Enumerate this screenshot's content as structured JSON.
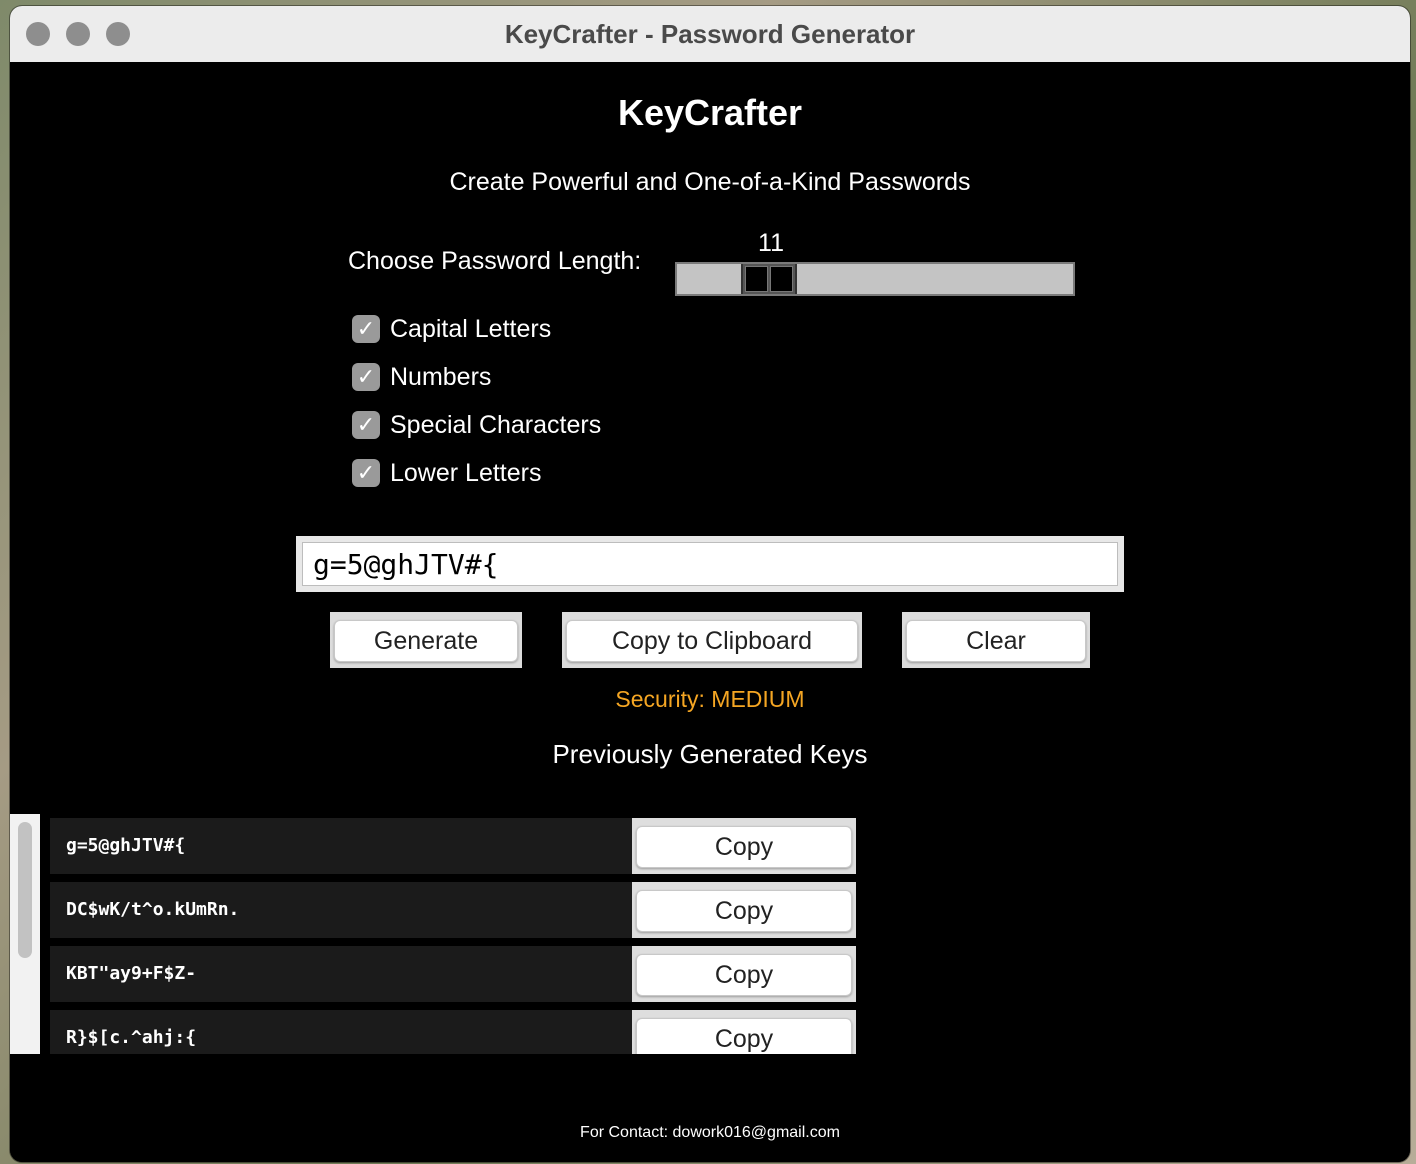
{
  "window": {
    "title": "KeyCrafter - Password Generator"
  },
  "header": {
    "app_title": "KeyCrafter",
    "subtitle": "Create Powerful and One-of-a-Kind Passwords"
  },
  "length": {
    "label": "Choose Password Length:",
    "value": "11"
  },
  "options": [
    {
      "label": "Capital Letters",
      "checked": true
    },
    {
      "label": "Numbers",
      "checked": true
    },
    {
      "label": "Special Characters",
      "checked": true
    },
    {
      "label": "Lower Letters",
      "checked": true
    }
  ],
  "password": {
    "value": "g=5@ghJTV#{"
  },
  "actions": {
    "generate": "Generate",
    "copy": "Copy to Clipboard",
    "clear": "Clear"
  },
  "security": {
    "text": "Security: MEDIUM",
    "color": "#f5a623"
  },
  "history": {
    "title": "Previously Generated Keys",
    "copy_label": "Copy",
    "items": [
      {
        "key": "g=5@ghJTV#{"
      },
      {
        "key": "DC$wK/t^o.kUmRn."
      },
      {
        "key": "KBT\"ay9+F$Z-"
      },
      {
        "key": "R}$[c.^ahj:{"
      }
    ]
  },
  "footer": {
    "text": "For Contact: dowork016@gmail.com"
  }
}
